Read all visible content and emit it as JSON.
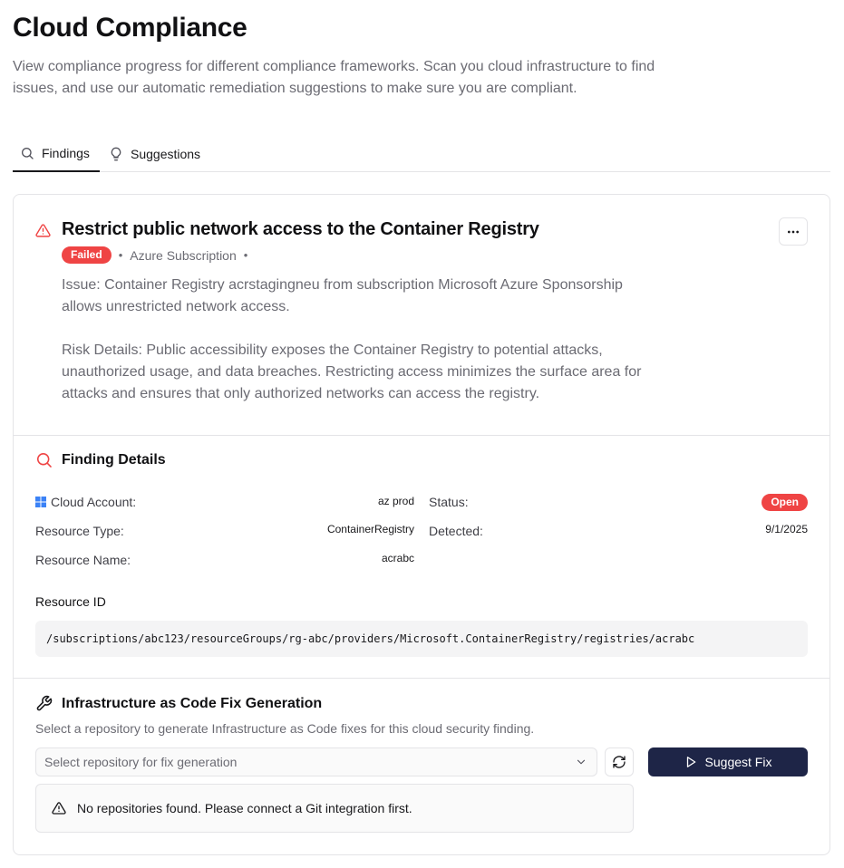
{
  "page": {
    "title": "Cloud Compliance",
    "description": "View compliance progress for different compliance frameworks. Scan you cloud infrastructure to find issues, and use our automatic remediation suggestions to make sure you are compliant."
  },
  "tabs": [
    {
      "label": "Findings",
      "icon": "search-icon",
      "active": true
    },
    {
      "label": "Suggestions",
      "icon": "lightbulb-icon",
      "active": false
    }
  ],
  "finding": {
    "title": "Restrict public network access to the Container Registry",
    "status_badge": "Failed",
    "separator": "•",
    "source": "Azure Subscription",
    "issue": "Issue: Container Registry acrstagingneu from subscription Microsoft Azure Sponsorship allows unrestricted network access.",
    "risk": "Risk Details: Public accessibility exposes the Container Registry to potential attacks, unauthorized usage, and data breaches. Restricting access minimizes the surface area for attacks and ensures that only authorized networks can access the registry."
  },
  "details": {
    "heading": "Finding Details",
    "cloud_account_label": "Cloud Account:",
    "cloud_account_value": "az prod",
    "resource_type_label": "Resource Type:",
    "resource_type_value": "ContainerRegistry",
    "resource_name_label": "Resource Name:",
    "resource_name_value": "acrabc",
    "status_label": "Status:",
    "status_value": "Open",
    "detected_label": "Detected:",
    "detected_value": "9/1/2025",
    "resource_id_label": "Resource ID",
    "resource_id_value": "/subscriptions/abc123/resourceGroups/rg-abc/providers/Microsoft.ContainerRegistry/registries/acrabc"
  },
  "iac": {
    "heading": "Infrastructure as Code Fix Generation",
    "description": "Select a repository to generate Infrastructure as Code fixes for this cloud security finding.",
    "select_placeholder": "Select repository for fix generation",
    "suggest_label": "Suggest Fix",
    "alert": "No repositories found. Please connect a Git integration first."
  },
  "colors": {
    "danger": "#ef4444",
    "primary_button": "#1e2547",
    "azure_blue": "#3b82f6"
  }
}
